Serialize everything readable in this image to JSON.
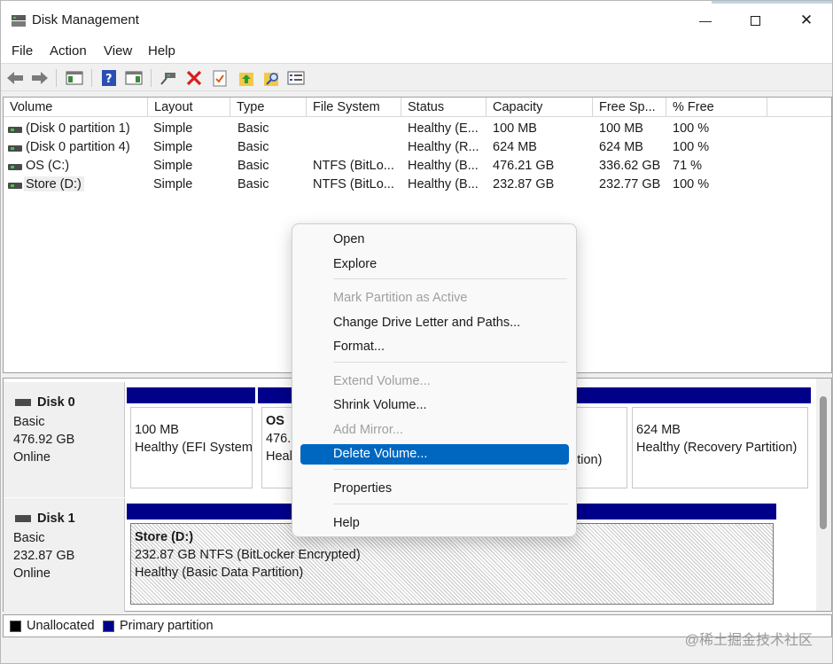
{
  "window": {
    "title": "Disk Management",
    "minimize_glyph": "—",
    "close_glyph": "✕"
  },
  "menubar": [
    "File",
    "Action",
    "View",
    "Help"
  ],
  "toolbar": {
    "icons": [
      "back-arrow-icon",
      "forward-arrow-icon",
      "console-tree-icon",
      "help-icon",
      "show-hide-action-pane-icon",
      "connect-disk-icon",
      "delete-icon",
      "properties-check-icon",
      "up-folder-icon",
      "search-folder-icon",
      "settings-list-icon"
    ]
  },
  "volume_list": {
    "columns": [
      "Volume",
      "Layout",
      "Type",
      "File System",
      "Status",
      "Capacity",
      "Free Sp...",
      "% Free"
    ],
    "rows": [
      {
        "volume": "(Disk 0 partition 1)",
        "layout": "Simple",
        "type": "Basic",
        "fs": "",
        "status": "Healthy (E...",
        "capacity": "100 MB",
        "free": "100 MB",
        "pct": "100 %"
      },
      {
        "volume": "(Disk 0 partition 4)",
        "layout": "Simple",
        "type": "Basic",
        "fs": "",
        "status": "Healthy (R...",
        "capacity": "624 MB",
        "free": "624 MB",
        "pct": "100 %"
      },
      {
        "volume": "OS (C:)",
        "layout": "Simple",
        "type": "Basic",
        "fs": "NTFS (BitLo...",
        "status": "Healthy (B...",
        "capacity": "476.21 GB",
        "free": "336.62 GB",
        "pct": "71 %"
      },
      {
        "volume": "Store (D:)",
        "layout": "Simple",
        "type": "Basic",
        "fs": "NTFS (BitLo...",
        "status": "Healthy (B...",
        "capacity": "232.87 GB",
        "free": "232.77 GB",
        "pct": "100 %"
      }
    ]
  },
  "disks": [
    {
      "name": "Disk 0",
      "type": "Basic",
      "size": "476.92 GB",
      "state": "Online",
      "partitions": [
        {
          "title": "",
          "line1": "100 MB",
          "line2": "Healthy (EFI System"
        },
        {
          "title": "OS",
          "line1": "476.2",
          "line2": "Heal"
        },
        {
          "title": "",
          "line1": "",
          "line2": "ition)"
        },
        {
          "title": "",
          "line1": "624 MB",
          "line2": "Healthy (Recovery Partition)"
        }
      ]
    },
    {
      "name": "Disk 1",
      "type": "Basic",
      "size": "232.87 GB",
      "state": "Online",
      "partitions": [
        {
          "title": "Store  (D:)",
          "line1": "232.87 GB NTFS (BitLocker Encrypted)",
          "line2": "Healthy (Basic Data Partition)"
        }
      ]
    }
  ],
  "legend": [
    {
      "label": "Unallocated",
      "color": "#000000"
    },
    {
      "label": "Primary partition",
      "color": "#00008b"
    }
  ],
  "context_menu": {
    "items": [
      {
        "label": "Open",
        "disabled": false
      },
      {
        "label": "Explore",
        "disabled": false
      },
      {
        "label": "Mark Partition as Active",
        "disabled": true
      },
      {
        "label": "Change Drive Letter and Paths...",
        "disabled": false
      },
      {
        "label": "Format...",
        "disabled": false
      },
      {
        "label": "Extend Volume...",
        "disabled": true
      },
      {
        "label": "Shrink Volume...",
        "disabled": false
      },
      {
        "label": "Add Mirror...",
        "disabled": true
      },
      {
        "label": "Delete Volume...",
        "disabled": false,
        "selected": true
      },
      {
        "label": "Properties",
        "disabled": false
      },
      {
        "label": "Help",
        "disabled": false
      }
    ]
  },
  "watermark": "@稀土掘金技术社区",
  "colors": {
    "accent": "#0067c0",
    "primary_partition": "#00008b"
  }
}
